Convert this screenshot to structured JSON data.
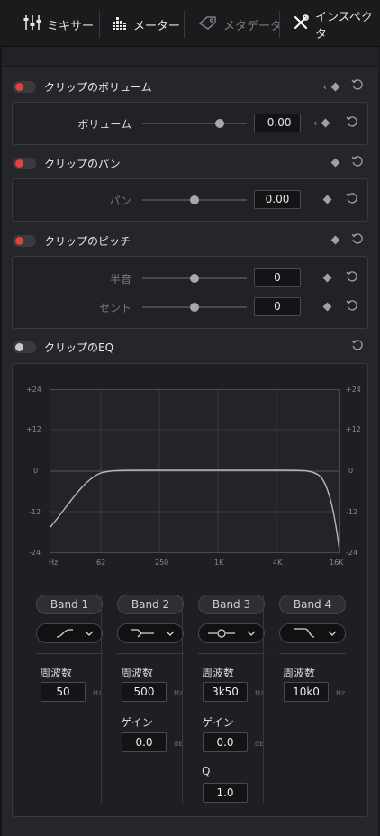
{
  "tabs": [
    {
      "label": "ミキサー",
      "icon": "mixer-icon"
    },
    {
      "label": "メーター",
      "icon": "meter-icon"
    },
    {
      "label": "メタデータ",
      "icon": "metadata-icon"
    },
    {
      "label": "インスペクタ",
      "icon": "inspector-icon"
    }
  ],
  "volume": {
    "title": "クリップのボリューム",
    "param_label": "ボリューム",
    "value": "-0.00",
    "slider_position": 0.74
  },
  "pan": {
    "title": "クリップのパン",
    "param_label": "パン",
    "value": "0.00",
    "slider_position": 0.5
  },
  "pitch": {
    "title": "クリップのピッチ",
    "semitone_label": "半音",
    "semitone_value": "0",
    "semitone_position": 0.5,
    "cent_label": "セント",
    "cent_value": "0",
    "cent_position": 0.5
  },
  "eq": {
    "title": "クリップのEQ",
    "y_ticks": [
      "+24",
      "+12",
      "0",
      "-12",
      "-24"
    ],
    "x_ticks": [
      "Hz",
      "62",
      "250",
      "1K",
      "4K",
      "16K"
    ],
    "bands": [
      {
        "name": "Band 1",
        "shape": "low-shelf",
        "freq_label": "周波数",
        "freq_value": "50",
        "freq_unit": "Hz"
      },
      {
        "name": "Band 2",
        "shape": "low-cut-bell",
        "freq_label": "周波数",
        "freq_value": "500",
        "freq_unit": "Hz",
        "gain_label": "ゲイン",
        "gain_value": "0.0",
        "gain_unit": "dB"
      },
      {
        "name": "Band 3",
        "shape": "bell",
        "freq_label": "周波数",
        "freq_value": "3k50",
        "freq_unit": "Hz",
        "gain_label": "ゲイン",
        "gain_value": "0.0",
        "gain_unit": "dB",
        "q_label": "Q",
        "q_value": "1.0"
      },
      {
        "name": "Band 4",
        "shape": "high-cut",
        "freq_label": "周波数",
        "freq_value": "10k0",
        "freq_unit": "Hz"
      }
    ]
  },
  "colors": {
    "accent_red": "#e34040",
    "panel": "#26262a",
    "field": "#141416"
  }
}
